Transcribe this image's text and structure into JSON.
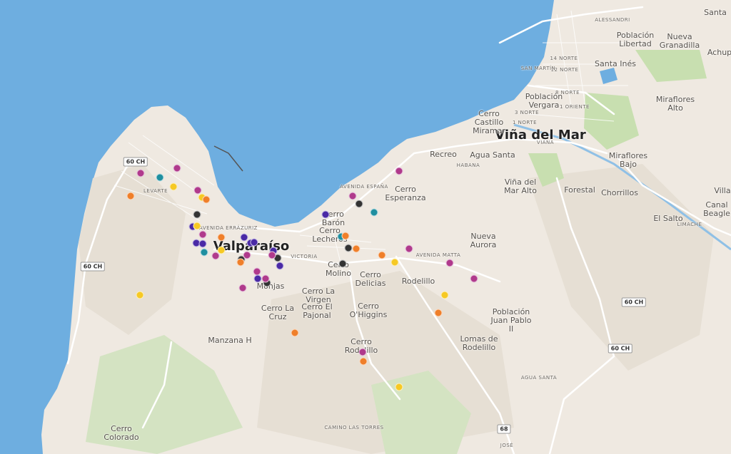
{
  "map": {
    "colors": {
      "water": "#6eaee0",
      "land": "#efe9e1",
      "hill": "#e6dfd4",
      "park": "#c8dfb0",
      "road": "#ffffff",
      "highway": "#f7f3ee"
    },
    "place_labels": [
      {
        "id": "valparaiso",
        "text": "Valparaíso",
        "kind": "city"
      },
      {
        "id": "vina",
        "text": "Viña del Mar",
        "kind": "city"
      },
      {
        "id": "alessandri",
        "text": "ALESSANDRI",
        "kind": "street"
      },
      {
        "id": "santa",
        "text": "Santa",
        "kind": "place"
      },
      {
        "id": "poblacion-libertad",
        "text": "Población\nLibertad",
        "kind": "place"
      },
      {
        "id": "nueva-granadilla",
        "text": "Nueva\nGranadilla",
        "kind": "place"
      },
      {
        "id": "achupallas",
        "text": "Achup",
        "kind": "place"
      },
      {
        "id": "santa-ines",
        "text": "Santa Inés",
        "kind": "place"
      },
      {
        "id": "14-norte",
        "text": "14 NORTE",
        "kind": "street"
      },
      {
        "id": "12-norte",
        "text": "12 NORTE",
        "kind": "street"
      },
      {
        "id": "san-martin",
        "text": "SAN MARTÍN",
        "kind": "street"
      },
      {
        "id": "8-norte",
        "text": "8 NORTE",
        "kind": "street"
      },
      {
        "id": "poblacion-vergara",
        "text": "Población\nVergara",
        "kind": "place"
      },
      {
        "id": "3-norte",
        "text": "3 NORTE",
        "kind": "street"
      },
      {
        "id": "1-norte",
        "text": "1 NORTE",
        "kind": "street"
      },
      {
        "id": "1-oriente",
        "text": "1 ORIENTE",
        "kind": "street"
      },
      {
        "id": "miraflores-alto",
        "text": "Miraflores\nAlto",
        "kind": "place"
      },
      {
        "id": "cerro-castillo",
        "text": "Cerro\nCastillo\nMiramar",
        "kind": "place"
      },
      {
        "id": "viana",
        "text": "VIANA",
        "kind": "street"
      },
      {
        "id": "recreo",
        "text": "Recreo",
        "kind": "place"
      },
      {
        "id": "agua-santa",
        "text": "Agua Santa",
        "kind": "place"
      },
      {
        "id": "habana",
        "text": "HABANA",
        "kind": "street"
      },
      {
        "id": "miraflores-bajo",
        "text": "Miraflores\nBajo",
        "kind": "place"
      },
      {
        "id": "vina-mar-alto",
        "text": "Viña del\nMar Alto",
        "kind": "place"
      },
      {
        "id": "forestal",
        "text": "Forestal",
        "kind": "place"
      },
      {
        "id": "chorrillos",
        "text": "Chorrillos",
        "kind": "place"
      },
      {
        "id": "villa",
        "text": "Villa",
        "kind": "place"
      },
      {
        "id": "canal-beagle",
        "text": "Canal\nBeagle",
        "kind": "place"
      },
      {
        "id": "el-salto",
        "text": "El Salto",
        "kind": "place"
      },
      {
        "id": "limache",
        "text": "LIMACHE",
        "kind": "street"
      },
      {
        "id": "avenida-espana",
        "text": "AVENIDA ESPAÑA",
        "kind": "street"
      },
      {
        "id": "cerro-esperanza",
        "text": "Cerro\nEsperanza",
        "kind": "place"
      },
      {
        "id": "cerro-baron",
        "text": "Cerro\nBarón",
        "kind": "place"
      },
      {
        "id": "cerro-lecheros",
        "text": "Cerro\nLecheros",
        "kind": "place"
      },
      {
        "id": "avenida-errazuriz",
        "text": "AVENIDA ERRÁZURIZ",
        "kind": "street"
      },
      {
        "id": "levarte",
        "text": "LEVARTE",
        "kind": "street"
      },
      {
        "id": "victoria",
        "text": "VICTORIA",
        "kind": "street"
      },
      {
        "id": "avenida-matta",
        "text": "AVENIDA MATTA",
        "kind": "street"
      },
      {
        "id": "nueva-aurora",
        "text": "Nueva\nAurora",
        "kind": "place"
      },
      {
        "id": "cerro-molino",
        "text": "Cerro\nMolino",
        "kind": "place"
      },
      {
        "id": "cerro-delicias",
        "text": "Cerro\nDelicias",
        "kind": "place"
      },
      {
        "id": "rodelillo",
        "text": "Rodelillo",
        "kind": "place"
      },
      {
        "id": "monjas",
        "text": "Monjas",
        "kind": "place"
      },
      {
        "id": "cerro-la-virgen",
        "text": "Cerro La\nVirgen",
        "kind": "place"
      },
      {
        "id": "cerro-el-pajonal",
        "text": "Cerro El\nPajonal",
        "kind": "place"
      },
      {
        "id": "cerro-la-cruz",
        "text": "Cerro La\nCruz",
        "kind": "place"
      },
      {
        "id": "cerro-ohiggins",
        "text": "Cerro\nO'Higgins",
        "kind": "place"
      },
      {
        "id": "poblacion-juan-pablo",
        "text": "Población\nJuan Pablo\nII",
        "kind": "place"
      },
      {
        "id": "lomas-rodelillo",
        "text": "Lomas de\nRodelillo",
        "kind": "place"
      },
      {
        "id": "manzana-h",
        "text": "Manzana H",
        "kind": "place"
      },
      {
        "id": "cerro-rodelillo-b",
        "text": "Cerro\nRodelillo",
        "kind": "place"
      },
      {
        "id": "camino-las-torres",
        "text": "CAMINO LAS TORRES",
        "kind": "street"
      },
      {
        "id": "agua-santa-road",
        "text": "AGUA SANTA",
        "kind": "street"
      },
      {
        "id": "jose",
        "text": "JOSÉ",
        "kind": "street"
      },
      {
        "id": "cerro-colorado",
        "text": "Cerro\nColorado",
        "kind": "place"
      }
    ],
    "route_shields": [
      {
        "id": "s1",
        "text": "60 CH"
      },
      {
        "id": "s2",
        "text": "60 CH"
      },
      {
        "id": "s3",
        "text": "60 CH"
      },
      {
        "id": "s4",
        "text": "60 CH"
      },
      {
        "id": "s5",
        "text": "68"
      }
    ],
    "marker_colors": {
      "magenta": "#b03a8c",
      "purple": "#4a2aa6",
      "black": "#333333",
      "orange": "#ef7f2a",
      "yellow": "#f6c924",
      "teal": "#1f8fa0"
    }
  }
}
